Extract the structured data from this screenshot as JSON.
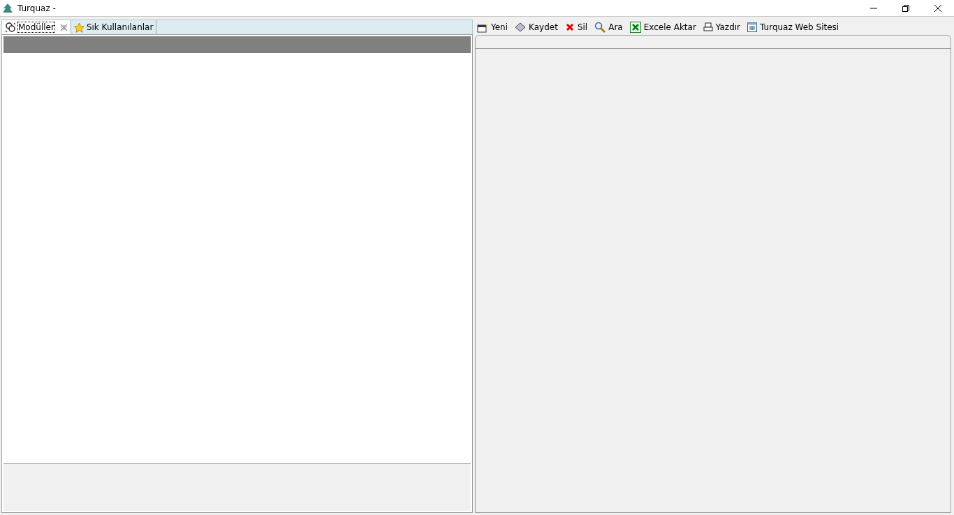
{
  "window": {
    "title": "Turquaz -"
  },
  "tabs": [
    {
      "label": "Modüller",
      "selected": true,
      "closable": true,
      "kind": "modules"
    },
    {
      "label": "Sık Kullanılanlar",
      "selected": false,
      "closable": false,
      "kind": "favorites"
    }
  ],
  "toolbar": [
    {
      "label": "Yeni",
      "kind": "new"
    },
    {
      "label": "Kaydet",
      "kind": "save"
    },
    {
      "label": "Sil",
      "kind": "delete"
    },
    {
      "label": "Ara",
      "kind": "search"
    },
    {
      "label": "Excele Aktar",
      "kind": "excel"
    },
    {
      "label": "Yazdır",
      "kind": "print"
    },
    {
      "label": "Turquaz Web Sitesi",
      "kind": "web"
    }
  ]
}
